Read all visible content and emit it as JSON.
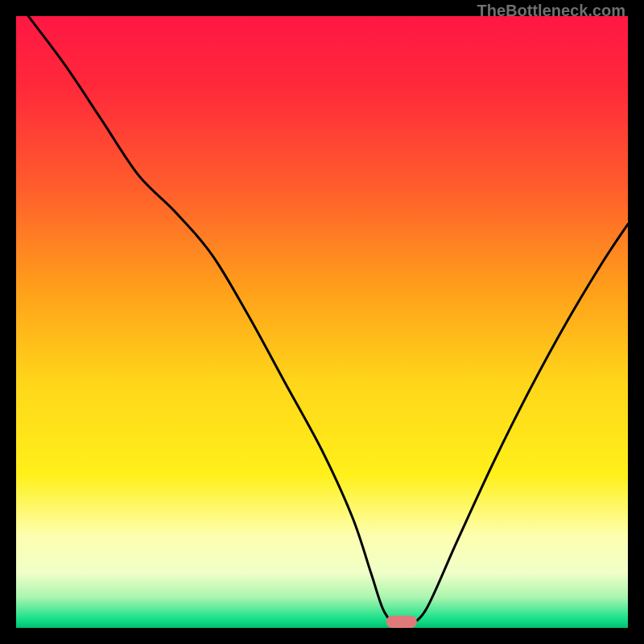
{
  "watermark": "TheBottleneck.com",
  "chart_data": {
    "type": "line",
    "title": "",
    "xlabel": "",
    "ylabel": "",
    "xlim": [
      0,
      100
    ],
    "ylim": [
      0,
      100
    ],
    "gradient_stops": [
      {
        "pos": 0.0,
        "color": "#ff1744"
      },
      {
        "pos": 0.12,
        "color": "#ff2a3a"
      },
      {
        "pos": 0.28,
        "color": "#ff5d2c"
      },
      {
        "pos": 0.45,
        "color": "#ffa11a"
      },
      {
        "pos": 0.6,
        "color": "#ffd61a"
      },
      {
        "pos": 0.75,
        "color": "#fff01a"
      },
      {
        "pos": 0.85,
        "color": "#fdffb0"
      },
      {
        "pos": 0.91,
        "color": "#f0ffc8"
      },
      {
        "pos": 0.95,
        "color": "#aaf5b0"
      },
      {
        "pos": 0.985,
        "color": "#18e08a"
      },
      {
        "pos": 1.0,
        "color": "#00c070"
      }
    ],
    "curve": {
      "name": "bottleneck",
      "x": [
        2,
        8,
        14,
        20,
        26,
        32,
        38,
        44,
        50,
        55,
        58,
        60,
        62,
        64,
        67,
        72,
        78,
        84,
        90,
        96,
        100
      ],
      "y": [
        100,
        92,
        83,
        74,
        68,
        61,
        51,
        40,
        29,
        18,
        9,
        3,
        0.5,
        0.5,
        3,
        14,
        27,
        39,
        50,
        60,
        66
      ]
    },
    "marker": {
      "x": 63,
      "y": 0,
      "width": 5,
      "height": 2,
      "color": "#e07a7a"
    }
  }
}
